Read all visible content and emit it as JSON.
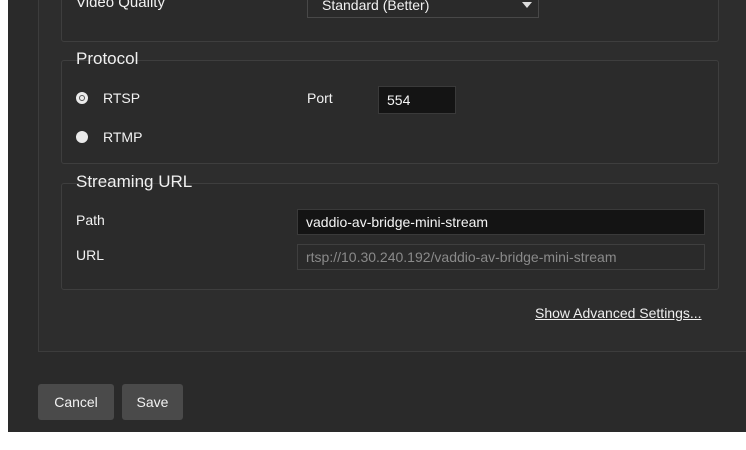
{
  "video_quality": {
    "label": "Video Quality",
    "selected": "Standard (Better)"
  },
  "protocol": {
    "legend": "Protocol",
    "options": [
      {
        "label": "RTSP",
        "checked": true
      },
      {
        "label": "RTMP",
        "checked": false
      }
    ],
    "port_label": "Port",
    "port_value": "554"
  },
  "streaming_url": {
    "legend": "Streaming URL",
    "path_label": "Path",
    "path_value": "vaddio-av-bridge-mini-stream",
    "url_label": "URL",
    "url_value": "rtsp://10.30.240.192/vaddio-av-bridge-mini-stream"
  },
  "advanced_link": "Show Advanced Settings...",
  "buttons": {
    "cancel": "Cancel",
    "save": "Save"
  }
}
